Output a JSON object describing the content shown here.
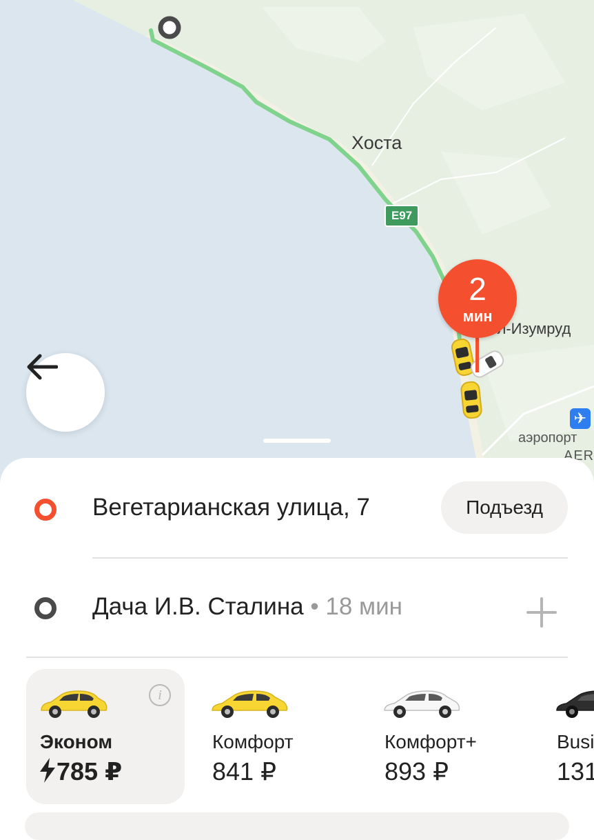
{
  "map": {
    "city_label": "Хоста",
    "district_label": "ел-Изумруд",
    "airport_label": "аэропорт",
    "airport_code": "AER",
    "road_badge": "E97",
    "eta": {
      "number": "2",
      "unit": "мин"
    },
    "colors": {
      "sea": "#dbe6ef",
      "land": "#e7efe3",
      "route": "#7fd38c",
      "pin": "#f4502f"
    }
  },
  "route": {
    "from": {
      "address": "Вегетарианская улица, 7",
      "entrance_button": "Подъезд"
    },
    "to": {
      "address": "Дача И.В. Сталина",
      "separator": " • ",
      "duration": "18 мин"
    }
  },
  "tariffs": [
    {
      "name": "Эконом",
      "price": "785 ₽",
      "selected": true,
      "car_color": "yellow",
      "icon": "lightning-icon"
    },
    {
      "name": "Комфорт",
      "price": "841 ₽",
      "selected": false,
      "car_color": "yellow"
    },
    {
      "name": "Комфорт+",
      "price": "893 ₽",
      "selected": false,
      "car_color": "white"
    },
    {
      "name": "Busi",
      "price": "131",
      "selected": false,
      "car_color": "black"
    }
  ],
  "accent_colors": {
    "origin": "#f4502f",
    "destination": "#4a4a4a",
    "taxi_yellow": "#f7d533"
  }
}
